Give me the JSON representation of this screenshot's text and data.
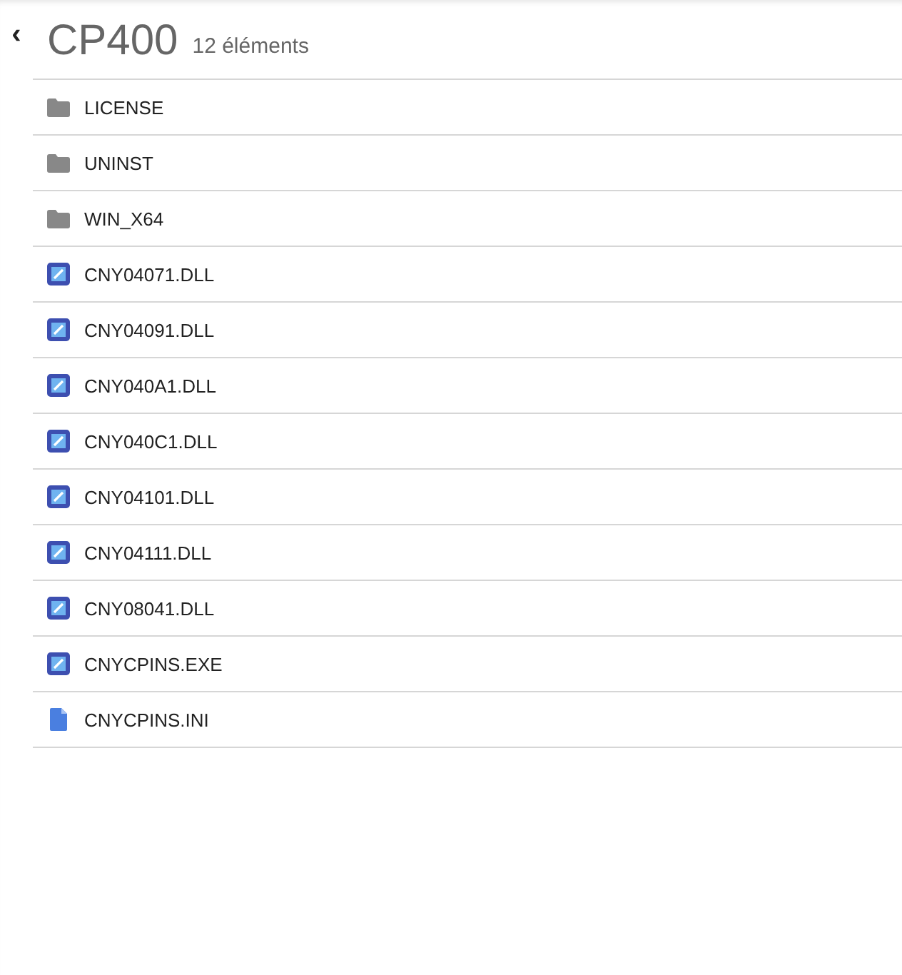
{
  "back_button": "‹",
  "header": {
    "title": "CP400",
    "count": "12 éléments"
  },
  "items": [
    {
      "name": "LICENSE",
      "kind": "folder"
    },
    {
      "name": "UNINST",
      "kind": "folder"
    },
    {
      "name": "WIN_X64",
      "kind": "folder"
    },
    {
      "name": "CNY04071.DLL",
      "kind": "app"
    },
    {
      "name": "CNY04091.DLL",
      "kind": "app"
    },
    {
      "name": "CNY040A1.DLL",
      "kind": "app"
    },
    {
      "name": "CNY040C1.DLL",
      "kind": "app"
    },
    {
      "name": "CNY04101.DLL",
      "kind": "app"
    },
    {
      "name": "CNY04111.DLL",
      "kind": "app"
    },
    {
      "name": "CNY08041.DLL",
      "kind": "app"
    },
    {
      "name": "CNYCPINS.EXE",
      "kind": "app"
    },
    {
      "name": "CNYCPINS.INI",
      "kind": "file"
    }
  ]
}
